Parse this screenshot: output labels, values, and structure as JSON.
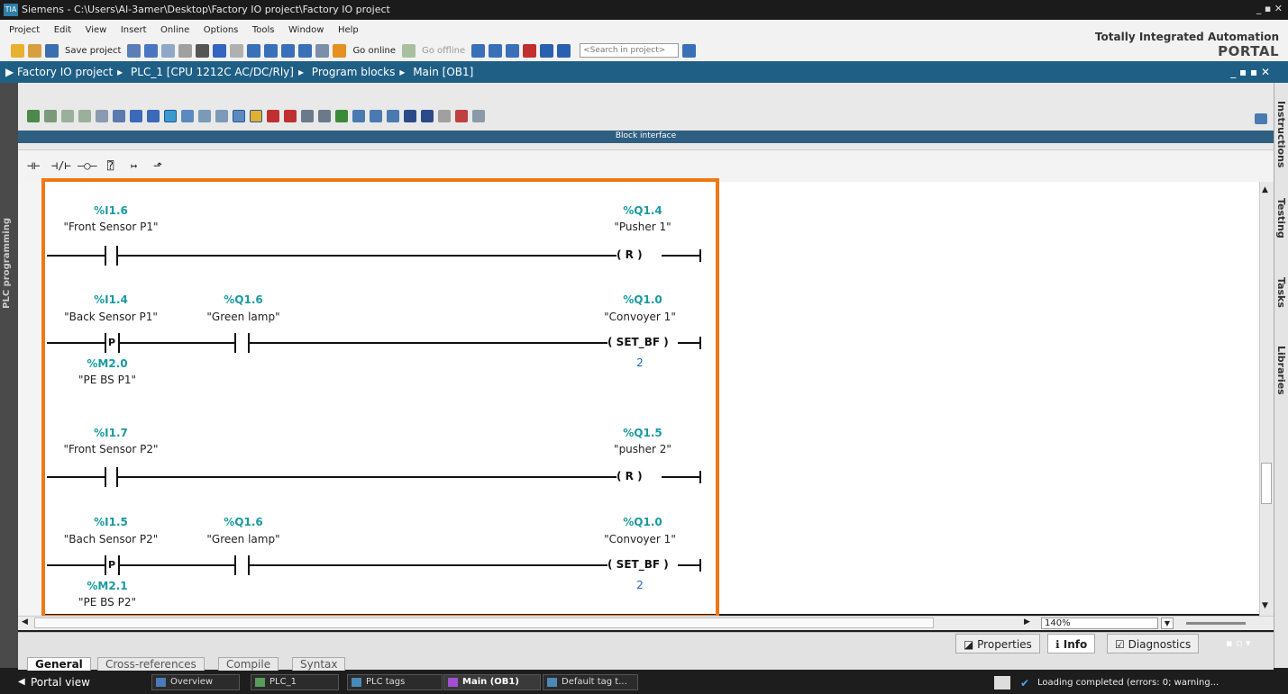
{
  "window": {
    "logo": "TIA",
    "title": "Siemens  -  C:\\Users\\Al-3amer\\Desktop\\Factory IO project\\Factory IO project",
    "controls": "_ ▪ ✕"
  },
  "menu": [
    "Project",
    "Edit",
    "View",
    "Insert",
    "Online",
    "Options",
    "Tools",
    "Window",
    "Help"
  ],
  "toolbar": {
    "save_project": "Save project",
    "go_online": "Go online",
    "go_offline": "Go offline",
    "search_placeholder": "<Search in project>"
  },
  "brand": {
    "line1": "Totally Integrated Automation",
    "line2": "PORTAL"
  },
  "breadcrumb": [
    "Factory IO project",
    "PLC_1 [CPU 1212C AC/DC/Rly]",
    "Program blocks",
    "Main [OB1]"
  ],
  "editor": {
    "block_interface": "Block interface",
    "left_tab": "PLC programming",
    "right_tabs": [
      "Instructions",
      "Testing",
      "Tasks",
      "Libraries"
    ],
    "zoom": "140%"
  },
  "networks": [
    {
      "contacts": [
        {
          "addr": "%I1.6",
          "tag": "\"Front Sensor P1\""
        }
      ],
      "coil": {
        "addr": "%Q1.4",
        "tag": "\"Pusher 1\"",
        "type": "R"
      }
    },
    {
      "contacts": [
        {
          "addr": "%I1.4",
          "tag": "\"Back Sensor P1\"",
          "type": "P",
          "edge_addr": "%M2.0",
          "edge_tag": "\"PE BS P1\""
        },
        {
          "addr": "%Q1.6",
          "tag": "\"Green lamp\""
        }
      ],
      "coil": {
        "addr": "%Q1.0",
        "tag": "\"Convoyer 1\"",
        "type": "SET_BF",
        "count": "2"
      }
    },
    {
      "contacts": [
        {
          "addr": "%I1.7",
          "tag": "\"Front Sensor P2\""
        }
      ],
      "coil": {
        "addr": "%Q1.5",
        "tag": "\"pusher 2\"",
        "type": "R"
      }
    },
    {
      "contacts": [
        {
          "addr": "%I1.5",
          "tag": "\"Bach Sensor P2\"",
          "type": "P",
          "edge_addr": "%M2.1",
          "edge_tag": "\"PE BS P2\""
        },
        {
          "addr": "%Q1.6",
          "tag": "\"Green lamp\""
        }
      ],
      "coil": {
        "addr": "%Q1.0",
        "tag": "\"Convoyer 1\"",
        "type": "SET_BF",
        "count": "2"
      }
    }
  ],
  "panel_tabs": [
    "Properties",
    "Info",
    "Diagnostics"
  ],
  "info_tabs": [
    "General",
    "Cross-references",
    "Compile",
    "Syntax"
  ],
  "taskbar": {
    "portal_view": "Portal view",
    "items": [
      "Overview",
      "PLC_1",
      "PLC tags",
      "Main (OB1)",
      "Default tag t..."
    ],
    "status": "Loading completed (errors: 0; warning..."
  }
}
